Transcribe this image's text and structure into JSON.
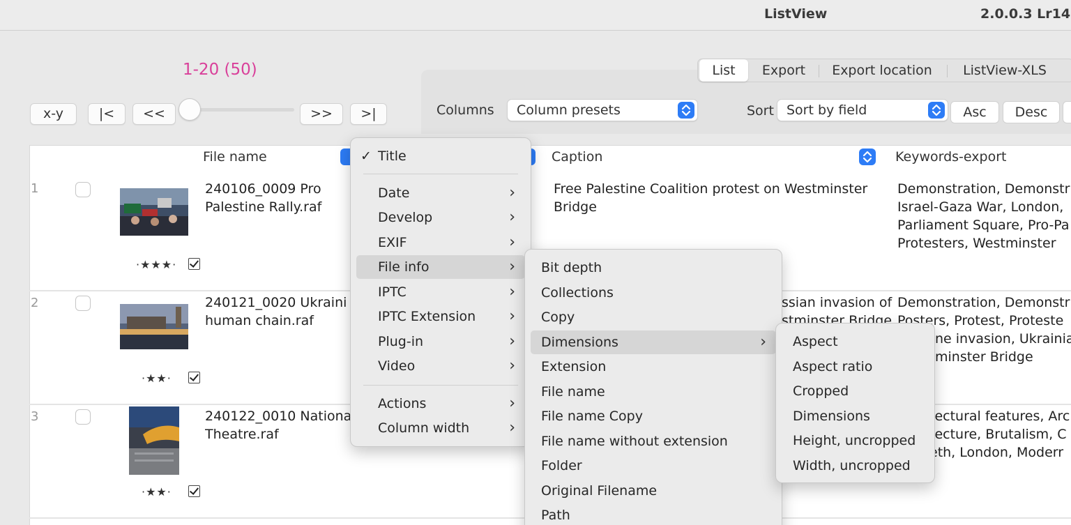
{
  "app": {
    "name": "ListView",
    "version": "2.0.0.3 Lr14."
  },
  "nav": {
    "range": "1-20 (50)",
    "buttons": {
      "xy": "x-y",
      "first": "|<",
      "prev": "<<",
      "next": ">>",
      "last": ">|"
    }
  },
  "tabs": [
    "List",
    "Export",
    "Export location",
    "ListView-XLS"
  ],
  "active_tab": "List",
  "toolbar": {
    "columns_label": "Columns",
    "columns_value": "Column presets",
    "sort_label": "Sort",
    "sort_value": "Sort by field",
    "asc": "Asc",
    "desc": "Desc"
  },
  "columns": [
    "File name",
    "Caption",
    "Keywords-export"
  ],
  "rows": [
    {
      "num": "1",
      "rating": "·★★★·",
      "title": [
        "240106_0009 Pro",
        "Palestine Rally.raf"
      ],
      "caption": [
        "Free Palestine Coalition protest on Westminster",
        "Bridge"
      ],
      "keywords": [
        "Demonstration, Demonstr",
        "Israel-Gaza War, London,",
        "Parliament Square, Pro-Pa",
        "Protesters, Westminster"
      ]
    },
    {
      "num": "2",
      "rating": "·★★·",
      "title": [
        "240121_0020 Ukraini",
        "human chain.raf"
      ],
      "caption": [
        "ssian invasion of",
        "stminster Bridge"
      ],
      "keywords": [
        "Demonstration, Demonstr",
        "Posters, Protest, Proteste",
        "ne invasion, Ukrainia",
        "minster Bridge"
      ]
    },
    {
      "num": "3",
      "rating": "·★★·",
      "title": [
        "240122_0010 Nationa",
        "Theatre.raf"
      ],
      "caption": [],
      "keywords": [
        "tectural features, Arc",
        "tecture, Brutalism, C",
        "eth, London, Moderr"
      ]
    }
  ],
  "menu1": {
    "checked_item": "Title",
    "items": [
      "Date",
      "Develop",
      "EXIF",
      "File info",
      "IPTC",
      "IPTC Extension",
      "Plug-in",
      "Video"
    ],
    "items2": [
      "Actions",
      "Column width"
    ],
    "highlighted": "File info"
  },
  "menu2": {
    "items": [
      "Bit depth",
      "Collections",
      "Copy",
      "Dimensions",
      "Extension",
      "File name",
      "File name Copy",
      "File name without extension",
      "Folder",
      "Original Filename",
      "Path"
    ],
    "highlighted": "Dimensions"
  },
  "menu3": {
    "items": [
      "Aspect",
      "Aspect ratio",
      "Cropped",
      "Dimensions",
      "Height, uncropped",
      "Width, uncropped"
    ]
  },
  "colors": {
    "accent": "#2d7cf6",
    "range": "#d9409a"
  }
}
